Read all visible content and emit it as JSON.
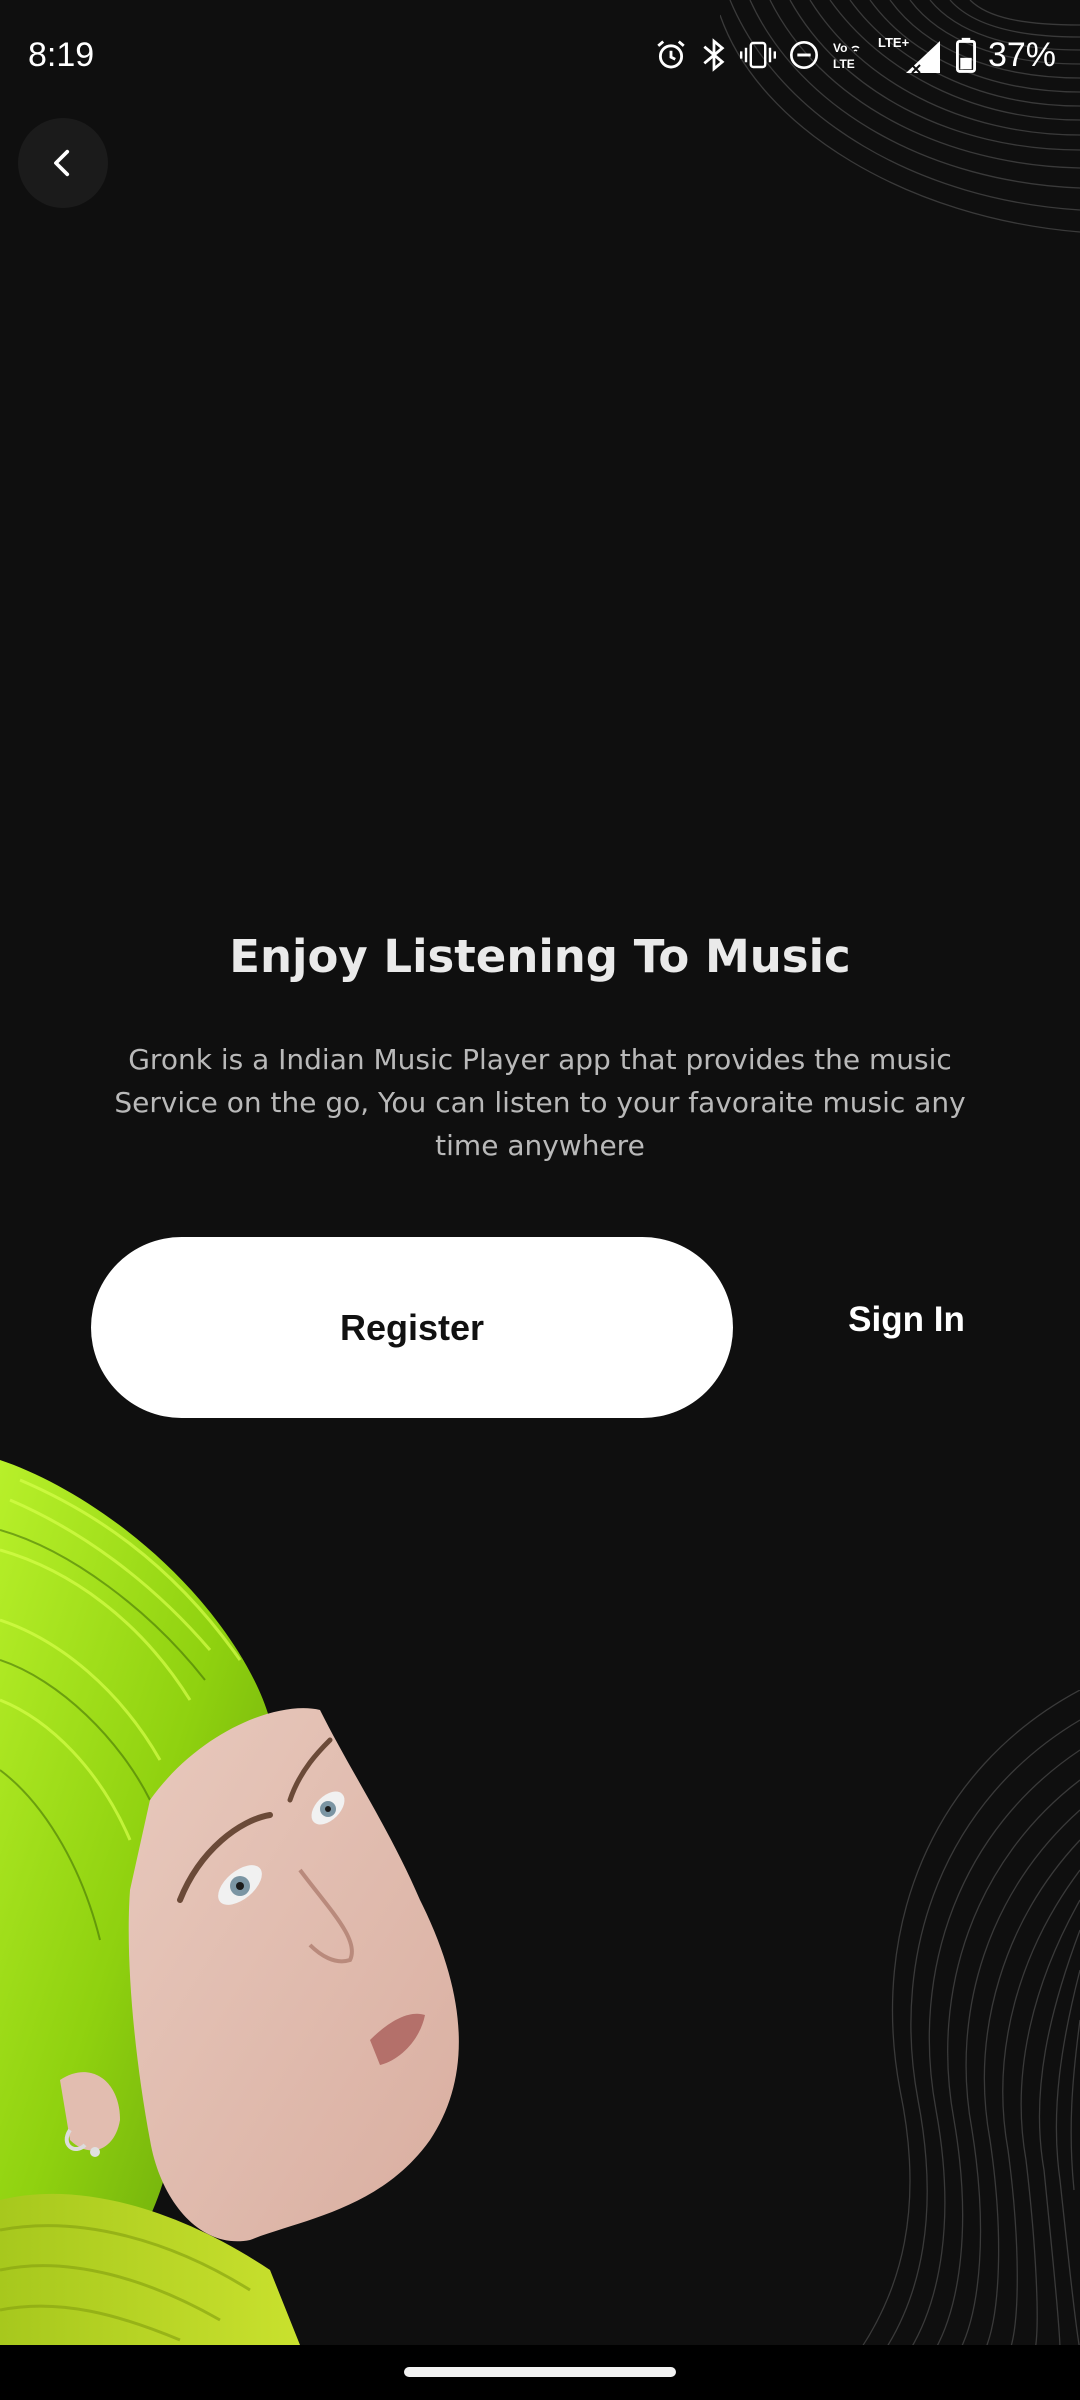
{
  "status_bar": {
    "time": "8:19",
    "battery_percent": "37%",
    "icons": [
      "alarm-icon",
      "bluetooth-icon",
      "vibrate-icon",
      "do-not-disturb-icon",
      "volte-icon",
      "lte-icon",
      "signal-icon",
      "battery-icon"
    ],
    "volte_label": "Vo LTE",
    "lte_label": "LTE+"
  },
  "header": {
    "back_icon": "chevron-left-icon"
  },
  "welcome": {
    "title": "Enjoy Listening To Music",
    "description": "Gronk is a Indian Music Player app that provides the music Service on the go, You can listen to your favoraite music any time anywhere"
  },
  "actions": {
    "register_label": "Register",
    "signin_label": "Sign In"
  },
  "colors": {
    "background": "#0f0f0f",
    "primary_button": "#ffffff",
    "hair_accent": "#a9e21a"
  }
}
